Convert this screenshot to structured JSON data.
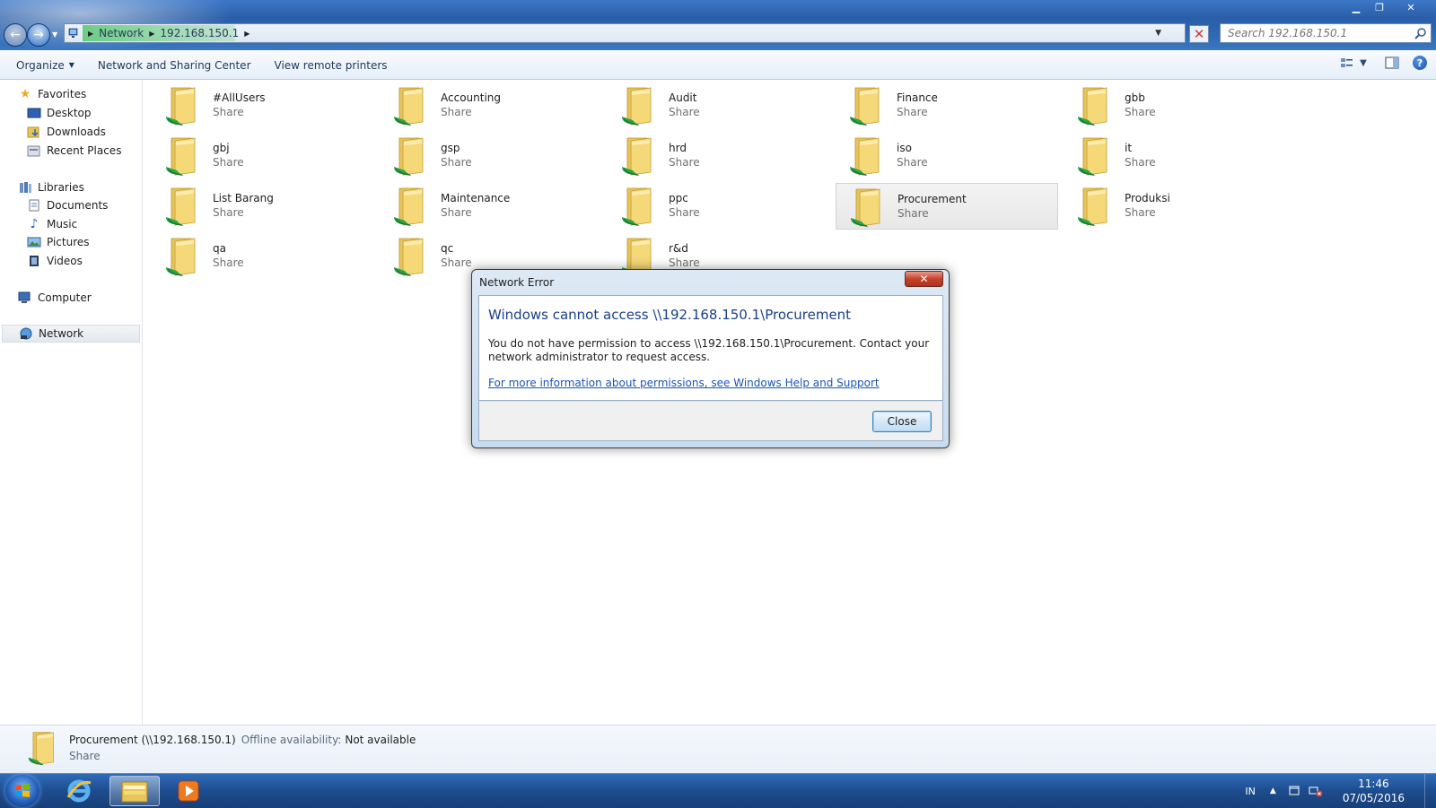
{
  "window": {
    "breadcrumb": [
      "Network",
      "192.168.150.1"
    ],
    "search_placeholder": "Search 192.168.150.1"
  },
  "toolbar": {
    "organize": "Organize",
    "network_sharing": "Network and Sharing Center",
    "remote_printers": "View remote printers"
  },
  "sidebar": {
    "favorites": "Favorites",
    "desktop": "Desktop",
    "downloads": "Downloads",
    "recent": "Recent Places",
    "libraries": "Libraries",
    "documents": "Documents",
    "music": "Music",
    "pictures": "Pictures",
    "videos": "Videos",
    "computer": "Computer",
    "network": "Network"
  },
  "shares": [
    {
      "name": "#AllUsers",
      "type": "Share"
    },
    {
      "name": "Accounting",
      "type": "Share"
    },
    {
      "name": "Audit",
      "type": "Share"
    },
    {
      "name": "Finance",
      "type": "Share"
    },
    {
      "name": "gbb",
      "type": "Share"
    },
    {
      "name": "gbj",
      "type": "Share"
    },
    {
      "name": "gsp",
      "type": "Share"
    },
    {
      "name": "hrd",
      "type": "Share"
    },
    {
      "name": "iso",
      "type": "Share"
    },
    {
      "name": "it",
      "type": "Share"
    },
    {
      "name": "List Barang",
      "type": "Share"
    },
    {
      "name": "Maintenance",
      "type": "Share"
    },
    {
      "name": "ppc",
      "type": "Share"
    },
    {
      "name": "Procurement",
      "type": "Share"
    },
    {
      "name": "Produksi",
      "type": "Share"
    },
    {
      "name": "qa",
      "type": "Share"
    },
    {
      "name": "qc",
      "type": "Share"
    },
    {
      "name": "r&d",
      "type": "Share"
    }
  ],
  "details": {
    "name": "Procurement (\\\\192.168.150.1)",
    "offline_label": "Offline availability:",
    "offline_value": "Not available",
    "type": "Share"
  },
  "dialog": {
    "title": "Network Error",
    "close_x": "✕",
    "main": "Windows cannot access \\\\192.168.150.1\\Procurement",
    "text": "You do not have permission to access \\\\192.168.150.1\\Procurement. Contact your network administrator to request access.",
    "link": "For more information about permissions, see Windows Help and Support",
    "close_button": "Close"
  },
  "taskbar": {
    "language": "IN",
    "time": "11:46",
    "date": "07/05/2016"
  },
  "colors": {
    "accent": "#1a3f88",
    "link": "#1a55b8",
    "taskbar": "#1d4c8e"
  }
}
